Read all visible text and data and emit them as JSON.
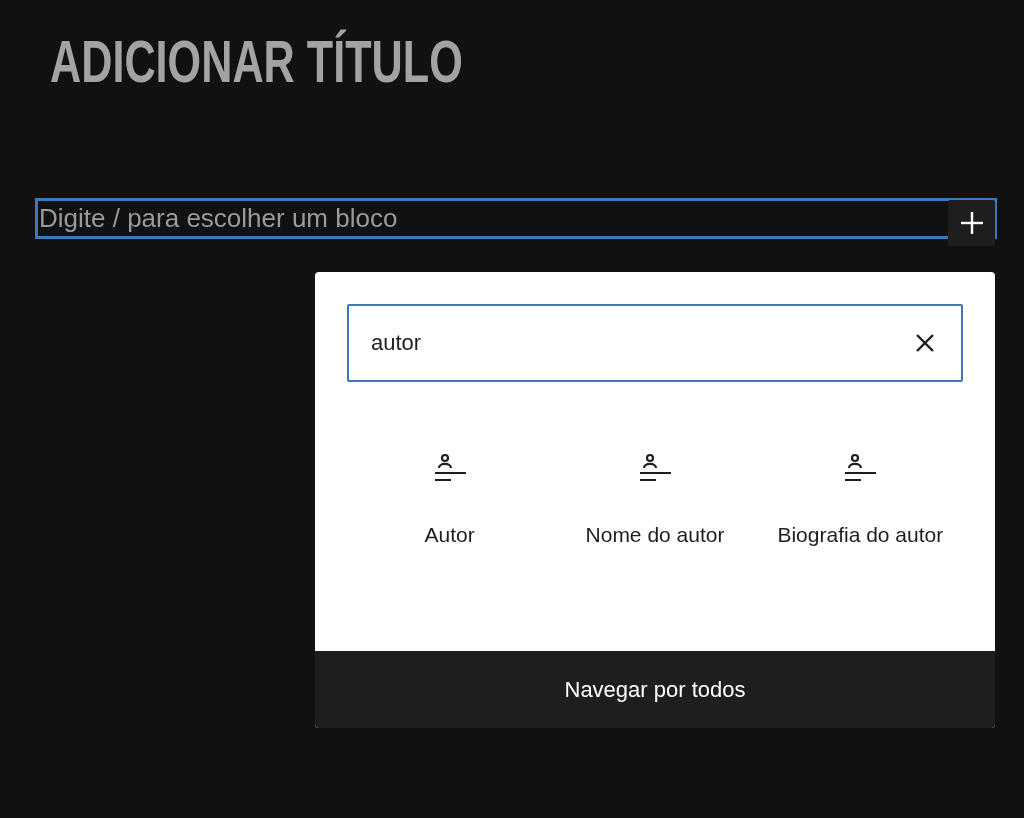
{
  "title": "ADICIONAR TÍTULO",
  "block_field": {
    "placeholder": "Digite / para escolher um bloco"
  },
  "inserter": {
    "search": {
      "value": "autor"
    },
    "results": [
      {
        "label": "Autor"
      },
      {
        "label": "Nome do autor"
      },
      {
        "label": "Biografia do autor"
      }
    ],
    "footer_button": "Navegar por todos"
  }
}
